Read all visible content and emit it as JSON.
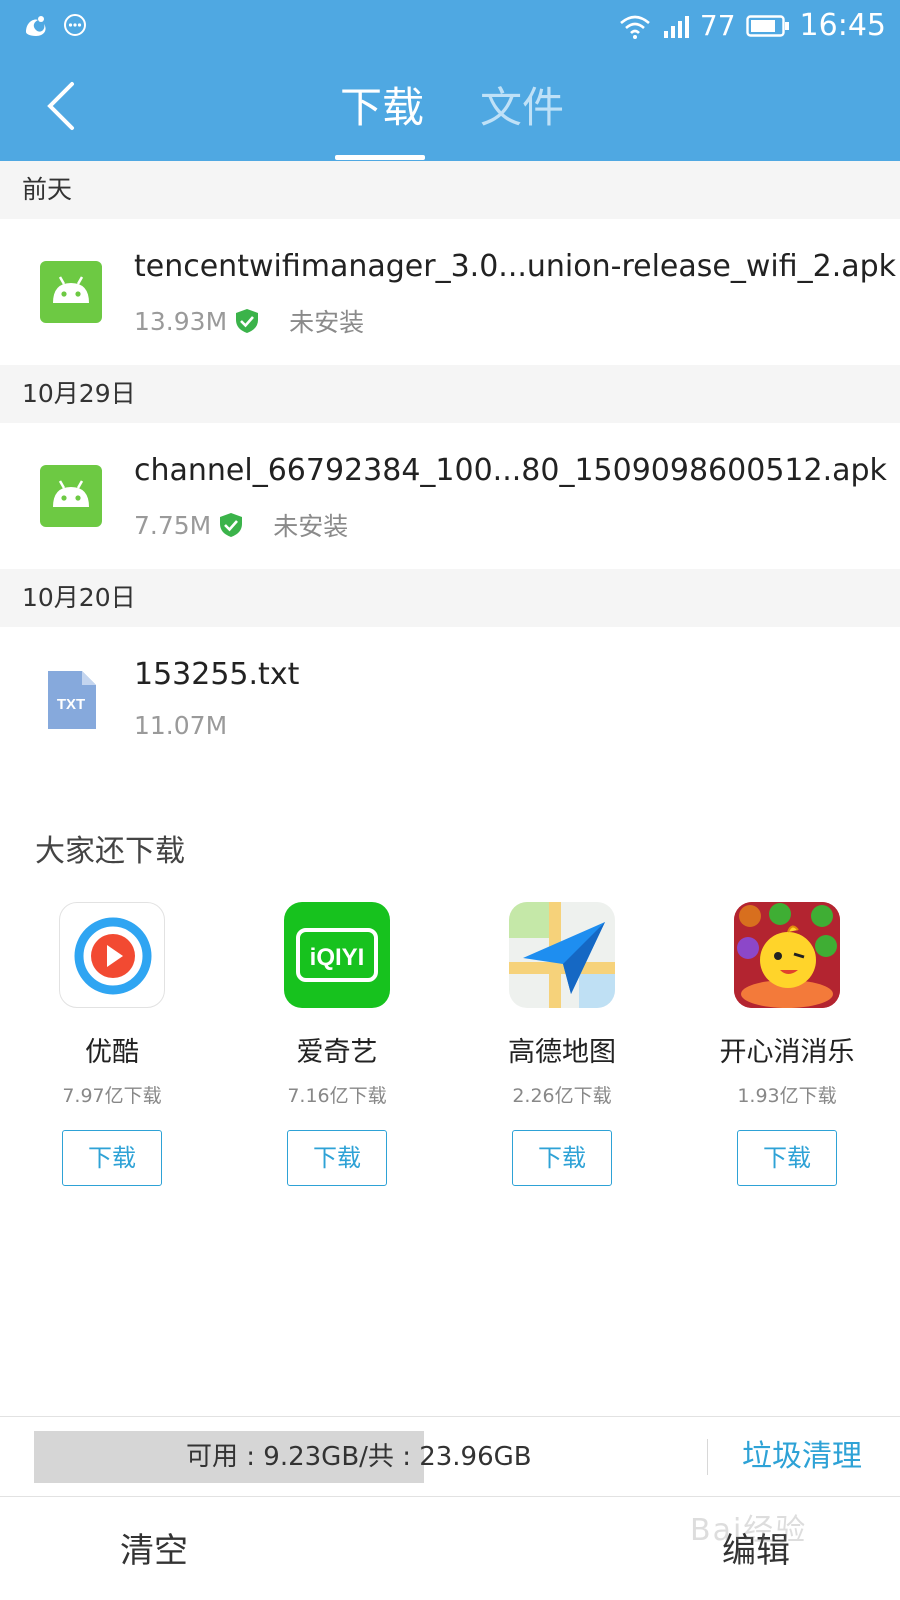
{
  "status_bar": {
    "signal_level": "77",
    "time": "16:45",
    "icons": [
      "uc-browser-icon",
      "chat-icon",
      "wifi-icon",
      "signal-icon",
      "battery-icon"
    ]
  },
  "header": {
    "back_icon": "chevron-left-icon",
    "tabs": [
      {
        "label": "下载",
        "active": true
      },
      {
        "label": "文件",
        "active": false
      }
    ]
  },
  "sections": [
    {
      "date": "前天",
      "items": [
        {
          "name": "tencentwifimanager_3.0...union-release_wifi_2.apk",
          "size": "13.93M",
          "state": "未安装",
          "icon": "android-icon"
        }
      ]
    },
    {
      "date": "10月29日",
      "items": [
        {
          "name": "channel_66792384_100...80_1509098600512.apk",
          "size": "7.75M",
          "state": "未安装",
          "icon": "android-icon"
        }
      ]
    },
    {
      "date": "10月20日",
      "items": [
        {
          "name": "153255.txt",
          "size": "11.07M",
          "state": "",
          "icon": "txt-file-icon",
          "icon_label": "TXT"
        }
      ]
    }
  ],
  "recommend": {
    "title": "大家还下载",
    "apps": [
      {
        "name": "优酷",
        "downloads": "7.97亿下载",
        "button": "下载",
        "icon": "youku-icon"
      },
      {
        "name": "爱奇艺",
        "downloads": "7.16亿下载",
        "button": "下载",
        "icon": "iqiyi-icon",
        "icon_text": "iQIYI"
      },
      {
        "name": "高德地图",
        "downloads": "2.26亿下载",
        "button": "下载",
        "icon": "amap-icon"
      },
      {
        "name": "开心消消乐",
        "downloads": "1.93亿下载",
        "button": "下载",
        "icon": "happy-elimination-icon"
      }
    ]
  },
  "storage": {
    "text": "可用 : 9.23GB/共 : 23.96GB",
    "used_fraction": 0.61,
    "clean_label": "垃圾清理"
  },
  "bottom": {
    "clear_label": "清空",
    "edit_label": "编辑",
    "watermark": "Bai经验"
  },
  "colors": {
    "header_blue": "#4fa8e2",
    "accent_blue": "#2ea2d6",
    "android_green": "#6dc943",
    "shield_green": "#3bb34a"
  }
}
